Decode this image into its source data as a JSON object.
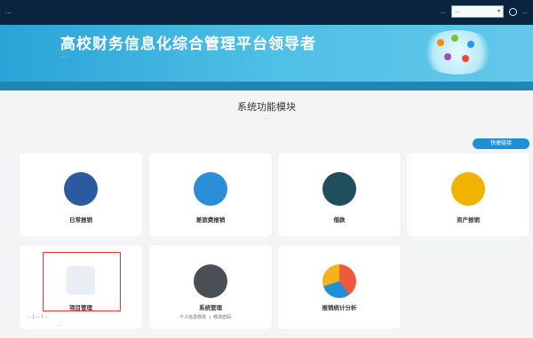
{
  "topbar": {
    "system_name": "…",
    "user_text": "…",
    "select_value": "…",
    "right_text": "…"
  },
  "banner": {
    "title": "高校财务信息化综合管理平台领导者",
    "subtitle": "…"
  },
  "section": {
    "title": "系统功能模块",
    "subtitle": "…"
  },
  "quick_button": "快捷链接",
  "modules": [
    {
      "label": "日常报销",
      "icon": "coin-person-icon",
      "color": "#2c5aa0"
    },
    {
      "label": "差旅费报销",
      "icon": "airplane-icon",
      "color": "#2a8fd8"
    },
    {
      "label": "借款",
      "icon": "wallet-icon",
      "color": "#1f4e5c"
    },
    {
      "label": "资产报销",
      "icon": "calculator-icon",
      "color": "#f0b400"
    },
    {
      "label": "项目管理",
      "icon": "table-icon",
      "color": "#e9eef4"
    },
    {
      "label": "系统管理",
      "icon": "gear-icon",
      "color": "#4a4f55"
    },
    {
      "label": "报销统计分析",
      "icon": "pie-chart-icon",
      "color": "#f05a3c"
    }
  ],
  "sublinks": {
    "project": [
      "…",
      "…",
      "…",
      "…"
    ],
    "system": [
      "个人信息修改",
      "修改密码"
    ]
  },
  "footer": "…"
}
